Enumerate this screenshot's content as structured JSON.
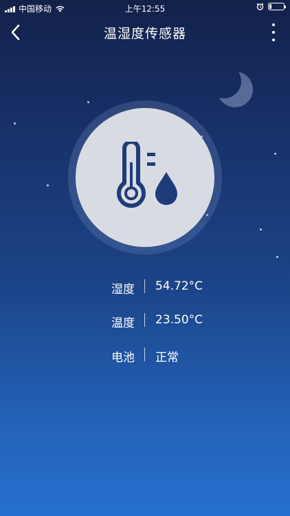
{
  "status_bar": {
    "carrier": "中国移动",
    "time": "上午12:55",
    "icons": [
      "signal-icon",
      "wifi-icon",
      "alarm-icon",
      "battery-icon"
    ]
  },
  "header": {
    "title": "温湿度传感器",
    "back_icon": "chevron-left-icon",
    "more_icon": "more-vertical-icon"
  },
  "device": {
    "icon": "thermometer-humidity-icon",
    "readings": [
      {
        "label": "湿度",
        "value": "54.72°C"
      },
      {
        "label": "温度",
        "value": "23.50°C"
      },
      {
        "label": "电池",
        "value": "正常"
      }
    ]
  },
  "colors": {
    "bg_top": "#13214a",
    "bg_bottom": "#2770cf",
    "icon_circle": "#d9dbe3",
    "icon_fill": "#1e3c7a",
    "text": "#ffffff"
  }
}
